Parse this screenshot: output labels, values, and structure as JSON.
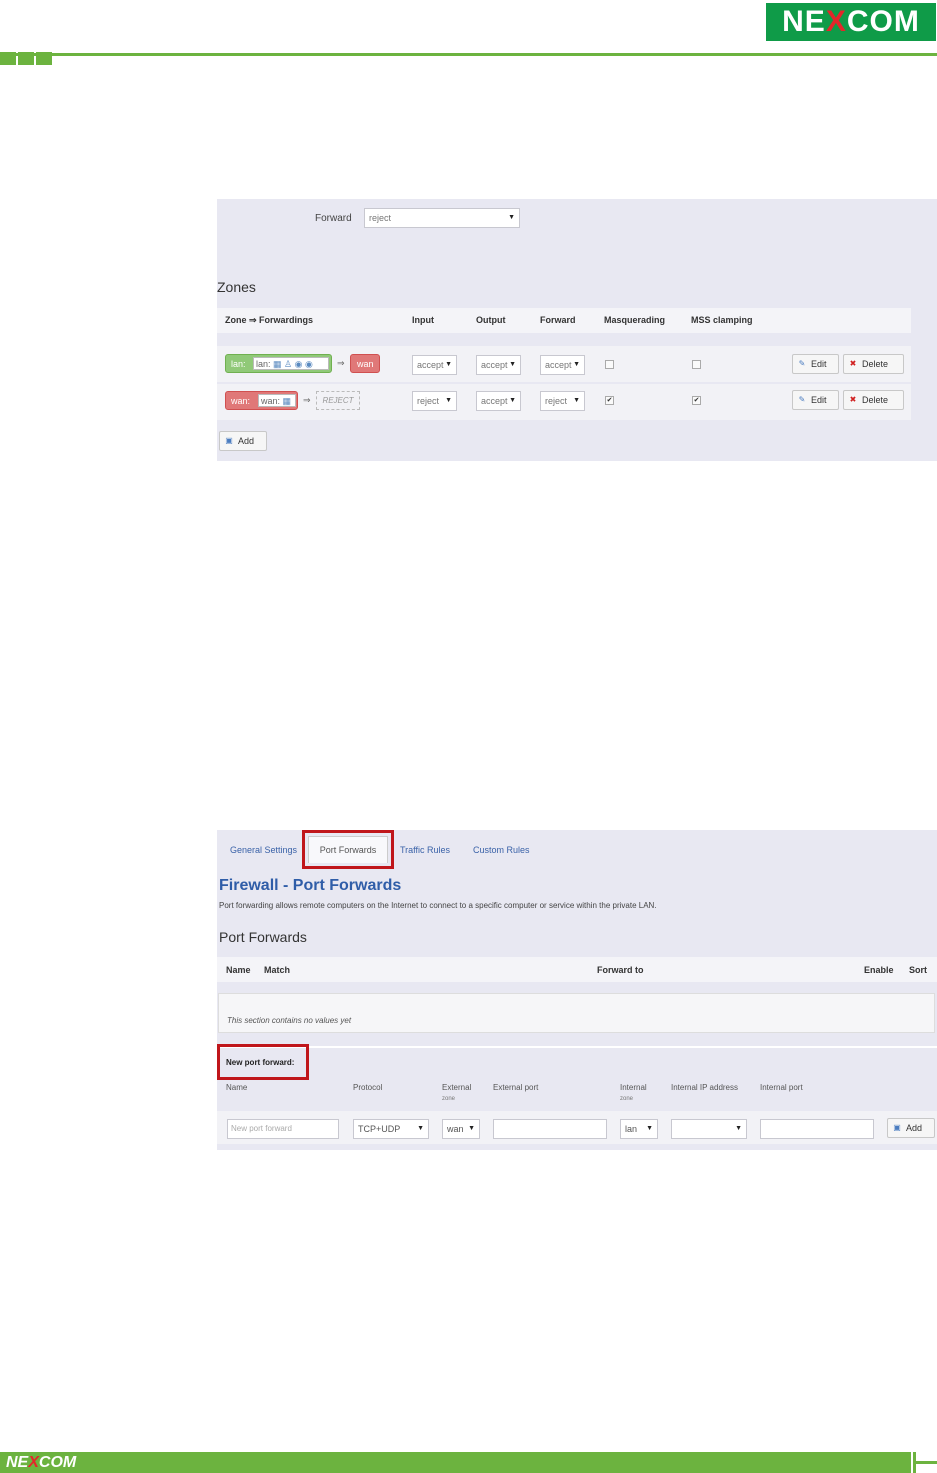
{
  "brand": {
    "logo_pre": "NE",
    "logo_x": "X",
    "logo_post": "COM",
    "accent": "#6cb33f",
    "logo_bg": "#0f9b48",
    "logo_x_color": "#e3262a"
  },
  "zones_panel": {
    "forward_label": "Forward",
    "forward_value": "reject",
    "title": "Zones",
    "headers": [
      "Zone ⇒ Forwardings",
      "Input",
      "Output",
      "Forward",
      "Masquerading",
      "MSS clamping"
    ],
    "rows": [
      {
        "zone": "lan:",
        "zone_inner": "lan:",
        "arrow": "⇒",
        "target": "wan",
        "input": "accept",
        "output": "accept",
        "forward": "accept",
        "masq": false,
        "mss": false
      },
      {
        "zone": "wan:",
        "zone_inner": "wan:",
        "arrow": "⇒",
        "target": "REJECT",
        "input": "reject",
        "output": "accept",
        "forward": "reject",
        "masq": true,
        "mss": true
      }
    ],
    "edit_label": "Edit",
    "delete_label": "Delete",
    "add_label": "Add"
  },
  "port_panel": {
    "tabs": [
      "General Settings",
      "Port Forwards",
      "Traffic Rules",
      "Custom Rules"
    ],
    "active_tab": "Port Forwards",
    "title": "Firewall - Port Forwards",
    "description": "Port forwarding allows remote computers on the Internet to connect to a specific computer or service within the private LAN.",
    "section_title": "Port Forwards",
    "headers": {
      "name": "Name",
      "match": "Match",
      "forward_to": "Forward to",
      "enable": "Enable",
      "sort": "Sort"
    },
    "empty_text": "This section contains no values yet",
    "new_title": "New port forward:",
    "new_cols": {
      "name": "Name",
      "protocol": "Protocol",
      "ext_zone": "External",
      "ext_zone_sub": "zone",
      "ext_port": "External port",
      "int_zone": "Internal",
      "int_zone_sub": "zone",
      "int_ip": "Internal IP address",
      "int_port": "Internal port"
    },
    "new_values": {
      "name_placeholder": "New port forward",
      "protocol": "TCP+UDP",
      "ext_zone": "wan",
      "int_zone": "lan",
      "int_ip": "",
      "add_label": "Add"
    }
  }
}
